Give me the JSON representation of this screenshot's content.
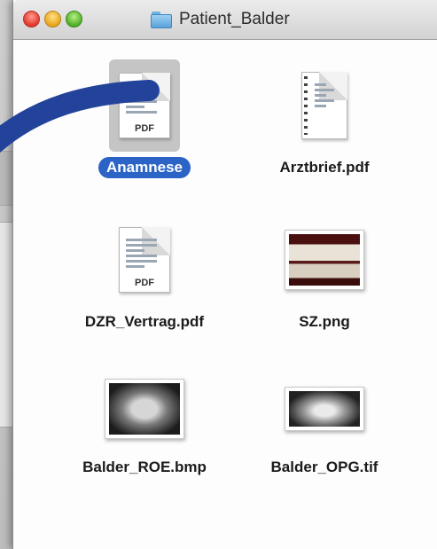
{
  "window": {
    "title": "Patient_Balder"
  },
  "icons": {
    "folder": "folder-icon",
    "pdf": "pdf-document-icon",
    "image": "image-thumbnail-icon"
  },
  "files": {
    "anamnese": {
      "label": "Anamnese",
      "tag": "PDF",
      "selected": true
    },
    "arztbrief": {
      "label": "Arztbrief.pdf"
    },
    "dzr": {
      "label": "DZR_Vertrag.pdf",
      "tag": "PDF"
    },
    "sz": {
      "label": "SZ.png"
    },
    "roe": {
      "label": "Balder_ROE.bmp"
    },
    "opg": {
      "label": "Balder_OPG.tif"
    }
  },
  "colors": {
    "selection": "#2b63c7",
    "arrow": "#23439a"
  }
}
